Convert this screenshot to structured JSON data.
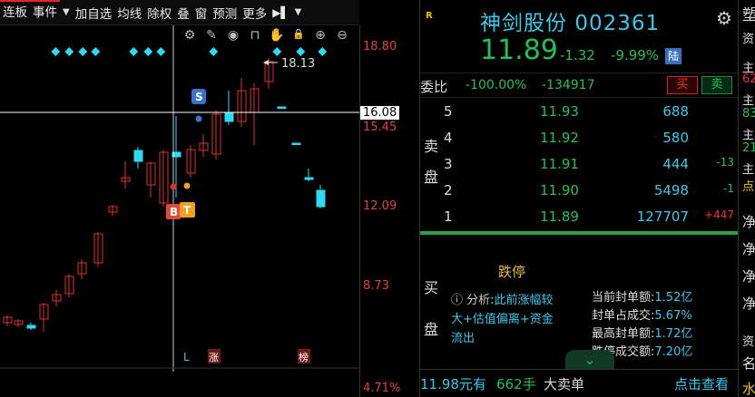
{
  "toolbar": {
    "items": [
      "连板",
      "事件",
      "加自选",
      "均线",
      "除权",
      "叠",
      "窗",
      "预测",
      "更多"
    ],
    "arrow_after_event": "▼",
    "side_arrow": "▶▌",
    "menu_arrow": "▼"
  },
  "chart": {
    "tool_icons": [
      "gear-outline-icon",
      "pencil-icon",
      "eye-icon",
      "bag-icon",
      "hand-icon",
      "lock-icon",
      "zoom-in-icon",
      "zoom-out-icon"
    ],
    "tool_glyphs": [
      "⚙",
      "✎",
      "◉",
      "⊓",
      "✋",
      "🔒",
      "⊕",
      "⊖"
    ],
    "annotation_high": "18.13",
    "badge_s": "S",
    "badge_b": "B",
    "badge_t": "T",
    "marker_l": "L",
    "marker_zhang": "涨",
    "marker_bang": "榜",
    "colors": {
      "up": "#e03030",
      "down": "#30d8f0",
      "diamond": "#30d8f0",
      "crosshair": "#ffffff"
    }
  },
  "price_axis": {
    "labels": [
      "18.80",
      "15.45",
      "12.09",
      "8.73"
    ],
    "crosshair_value": "16.08",
    "sub_pane_value": "4.71%"
  },
  "quote": {
    "logo": "R",
    "name": "神剑股份",
    "code": "002361",
    "price": "11.89",
    "change": "-1.32",
    "change_pct": "-9.99%",
    "lu_badge": "陆",
    "weibi_label": "委比",
    "weibi_pct": "-100.00%",
    "weibi_diff": "-134917",
    "buy_label": "买",
    "sell_label": "卖",
    "ask_side_chars": [
      "卖",
      "盘"
    ],
    "asks": [
      {
        "level": "5",
        "price": "11.93",
        "volume": "688",
        "change": ""
      },
      {
        "level": "4",
        "price": "11.92",
        "volume": "580",
        "change": ""
      },
      {
        "level": "3",
        "price": "11.91",
        "volume": "444",
        "change": "-13"
      },
      {
        "level": "2",
        "price": "11.90",
        "volume": "5498",
        "change": "-1"
      },
      {
        "level": "1",
        "price": "11.89",
        "volume": "127707",
        "change": "+447"
      }
    ],
    "bid_side_chars": [
      "买",
      "盘"
    ],
    "limit_status": "跌停",
    "analysis_label": "分析:",
    "analysis_text": "此前涨幅较大+估值偏离+资金流出",
    "stats": [
      {
        "label": "当前封单额:",
        "value": "1.52亿"
      },
      {
        "label": "封单占成交:",
        "value": "5.67%"
      },
      {
        "label": "最高封单额:",
        "value": "1.72亿"
      },
      {
        "label": "跌停成交额:",
        "value": "7.20亿"
      }
    ],
    "expand_glyph": "⌄",
    "bottom_price": "11.98元有",
    "bottom_hands": "662手",
    "bottom_tag": "大卖单",
    "bottom_link": "点击查看"
  },
  "edge_panel": {
    "texts": [
      "塑",
      "资",
      "主",
      "62",
      "主",
      "83",
      "主",
      "21",
      "主",
      "点",
      "净",
      "净",
      "净",
      "净",
      "资",
      "名",
      "水"
    ]
  }
}
